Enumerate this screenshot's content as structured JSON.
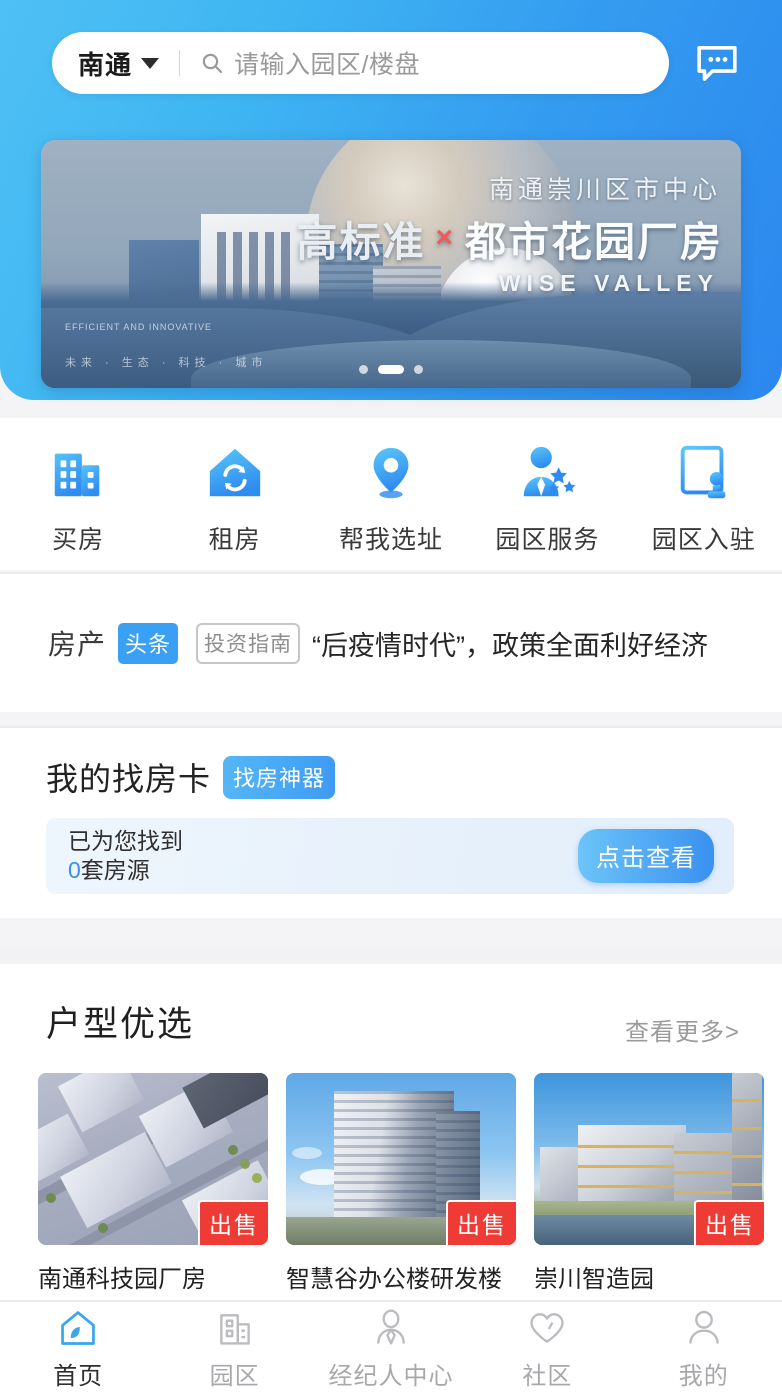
{
  "header": {
    "city": "南通",
    "city_caret_icon": "chevron-down-icon",
    "search_icon": "search-icon",
    "search_value": "",
    "search_placeholder": "请输入园区/楼盘",
    "chat_icon": "chat-bubble-icon"
  },
  "banner": {
    "subtitle": "南通崇川区市中心",
    "title_left": "高标准",
    "title_x": "×",
    "title_right": "都市花园厂房",
    "english": "WISE VALLEY",
    "tiny_top": "EFFICIENT AND\nINNOVATIVE",
    "tiny_bottom": "未来 · 生态 · 科技 · 城市",
    "slides": 3,
    "active_slide": 1
  },
  "quicknav": {
    "items": [
      {
        "label": "买房",
        "icon": "office-building-icon"
      },
      {
        "label": "租房",
        "icon": "house-refresh-icon"
      },
      {
        "label": "帮我选址",
        "icon": "location-pin-icon"
      },
      {
        "label": "园区服务",
        "icon": "agent-star-icon"
      },
      {
        "label": "园区入驻",
        "icon": "document-stamp-icon"
      }
    ]
  },
  "news": {
    "kicker": "房产",
    "badge": "头条",
    "tag": "投资指南",
    "title": "“后疫情时代”，政策全面利好经济"
  },
  "findcard": {
    "title": "我的找房卡",
    "badge": "找房神器",
    "line1": "已为您找到",
    "count": "0",
    "line2_suffix": "套房源",
    "button": "点击查看"
  },
  "section_huxing": {
    "title": "户型优选",
    "more": "查看更多>",
    "cards": [
      {
        "title": "南通科技园厂房",
        "badge": "出售",
        "image": "aerial-campus-photo"
      },
      {
        "title": "智慧谷办公楼研发楼",
        "badge": "出售",
        "image": "office-tower-photo"
      },
      {
        "title": "崇川智造园",
        "badge": "出售",
        "image": "waterfront-complex-photo"
      }
    ]
  },
  "tabbar": {
    "items": [
      {
        "label": "首页",
        "icon": "home-icon",
        "active": true
      },
      {
        "label": "园区",
        "icon": "park-building-icon",
        "active": false
      },
      {
        "label": "经纪人中心",
        "icon": "agent-person-icon",
        "active": false
      },
      {
        "label": "社区",
        "icon": "heart-icon",
        "active": false
      },
      {
        "label": "我的",
        "icon": "user-icon",
        "active": false
      }
    ]
  },
  "colors": {
    "header_gradient_start": "#4fc0f5",
    "header_gradient_end": "#2b87ee",
    "accent_blue": "#3a91ef",
    "badge_blue": "#3aa0f3",
    "sale_red": "#ef3b35",
    "tab_active": "#2f2f2f",
    "tab_inactive": "#a8a8ac"
  }
}
